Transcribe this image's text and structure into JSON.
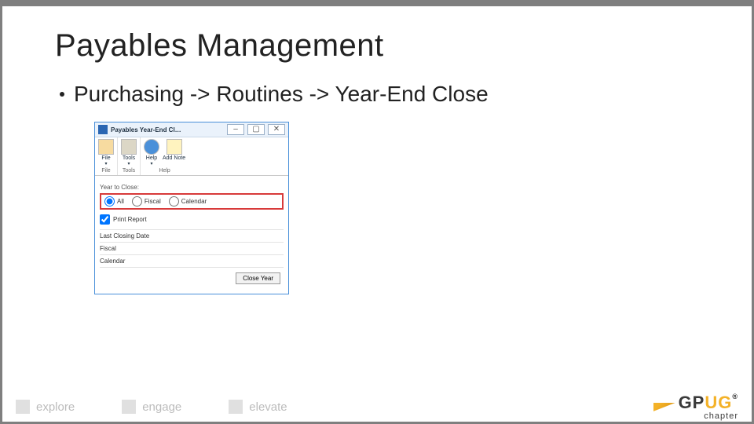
{
  "title": "Payables Management",
  "bullet": "Purchasing -> Routines -> Year-End Close",
  "window": {
    "title": "Payables Year-End Cl…",
    "ribbon": {
      "file_group": {
        "label": "File",
        "items": [
          {
            "label": "File"
          }
        ]
      },
      "tools_group": {
        "label": "Tools",
        "items": [
          {
            "label": "Tools"
          }
        ]
      },
      "help_group": {
        "label": "Help",
        "items": [
          {
            "label": "Help"
          },
          {
            "label": "Add Note"
          }
        ]
      }
    },
    "year_to_close_label": "Year to Close:",
    "radios": {
      "all": "All",
      "fiscal": "Fiscal",
      "calendar": "Calendar"
    },
    "print_report": "Print Report",
    "last_closing_date": "Last Closing Date",
    "fiscal_row": "Fiscal",
    "calendar_row": "Calendar",
    "close_btn": "Close Year"
  },
  "footer": {
    "explore": "explore",
    "engage": "engage",
    "elevate": "elevate"
  },
  "brand": {
    "gp": "GP",
    "ug": "UG",
    "chapter": "chapter"
  }
}
